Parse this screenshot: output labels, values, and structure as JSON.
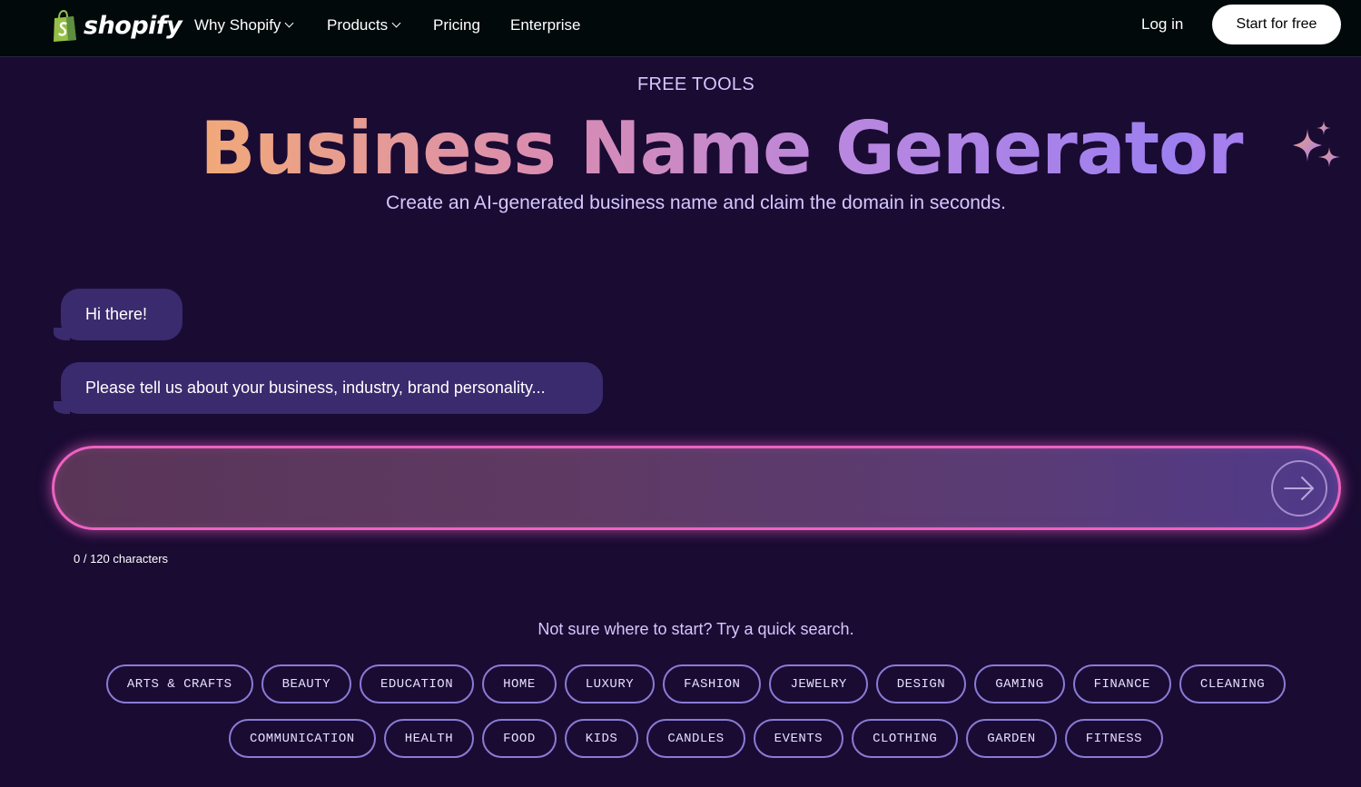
{
  "header": {
    "logo_text": "shopify",
    "nav": [
      {
        "label": "Why Shopify",
        "has_dropdown": true
      },
      {
        "label": "Products",
        "has_dropdown": true
      },
      {
        "label": "Pricing",
        "has_dropdown": false
      },
      {
        "label": "Enterprise",
        "has_dropdown": false
      }
    ],
    "login_label": "Log in",
    "cta_label": "Start for free"
  },
  "hero": {
    "eyebrow": "FREE TOOLS",
    "title": "Business Name Generator",
    "subtitle": "Create an AI-generated business name and claim the domain in seconds."
  },
  "chat": {
    "messages": [
      "Hi there!",
      "Please tell us about your business, industry, brand personality..."
    ]
  },
  "input": {
    "value": "",
    "placeholder": "",
    "char_count": "0 / 120 characters",
    "send_icon": "arrow-right-icon"
  },
  "quick_search": {
    "label": "Not sure where to start? Try a quick search.",
    "row_1": [
      "ARTS & CRAFTS",
      "BEAUTY",
      "EDUCATION",
      "HOME",
      "LUXURY",
      "FASHION",
      "JEWELRY",
      "DESIGN",
      "GAMING",
      "FINANCE",
      "CLEANING"
    ],
    "row_2": [
      "COMMUNICATION",
      "HEALTH",
      "FOOD",
      "KIDS",
      "CANDLES",
      "EVENTS",
      "CLOTHING",
      "GARDEN",
      "FITNESS"
    ]
  },
  "colors": {
    "background": "#1a0b33",
    "header_bg": "#02090b",
    "bubble_bg": "#3a2a6e",
    "input_border": "#ee62c2",
    "chip_border": "#8a7bd6"
  }
}
